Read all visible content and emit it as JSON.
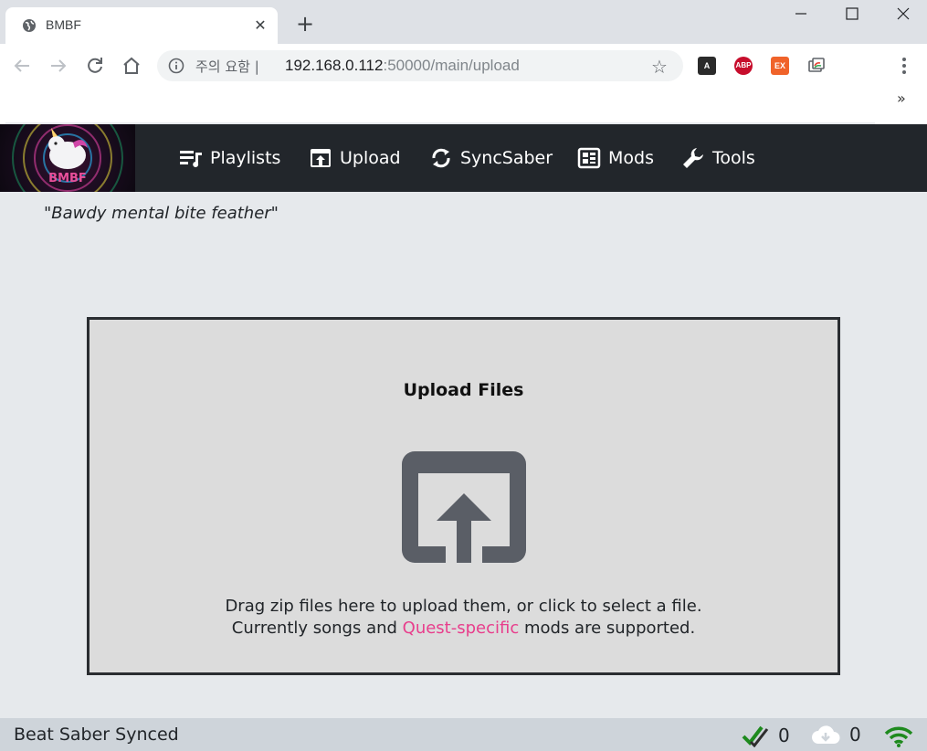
{
  "browser": {
    "tab_title": "BMBF",
    "tab_close": "✕",
    "new_tab": "+",
    "security_label": "주의 요함",
    "url_host": "192.168.0.112",
    "url_rest": ":50000/main/upload",
    "extensions": [
      {
        "name": "a",
        "label": "A",
        "color": "#2b2b2b"
      },
      {
        "name": "abp",
        "label": "ABP",
        "color": "#c70d2c"
      },
      {
        "name": "ex",
        "label": "EX",
        "color": "#f0632a"
      },
      {
        "name": "cast",
        "label": "",
        "color": "#ffffff"
      }
    ],
    "overflow": "»"
  },
  "app": {
    "logo_text": "BMBF",
    "nav": [
      {
        "label": "Playlists",
        "icon": "playlist-icon"
      },
      {
        "label": "Upload",
        "icon": "upload-icon"
      },
      {
        "label": "SyncSaber",
        "icon": "sync-icon"
      },
      {
        "label": "Mods",
        "icon": "mods-icon"
      },
      {
        "label": "Tools",
        "icon": "wrench-icon"
      }
    ],
    "quote": "\"Bawdy mental bite feather\"",
    "upload": {
      "title": "Upload Files",
      "line1": "Drag zip files here to upload them, or click to select a file.",
      "line2_before": "Currently songs and ",
      "line2_link": "Quest-specific",
      "line2_after": " mods are supported."
    },
    "status": {
      "text": "Beat Saber Synced",
      "done_count": "0",
      "download_count": "0"
    }
  },
  "colors": {
    "navbar": "#22262b",
    "accent_pink": "#e83e8c",
    "success_green": "#1e8a1e"
  }
}
